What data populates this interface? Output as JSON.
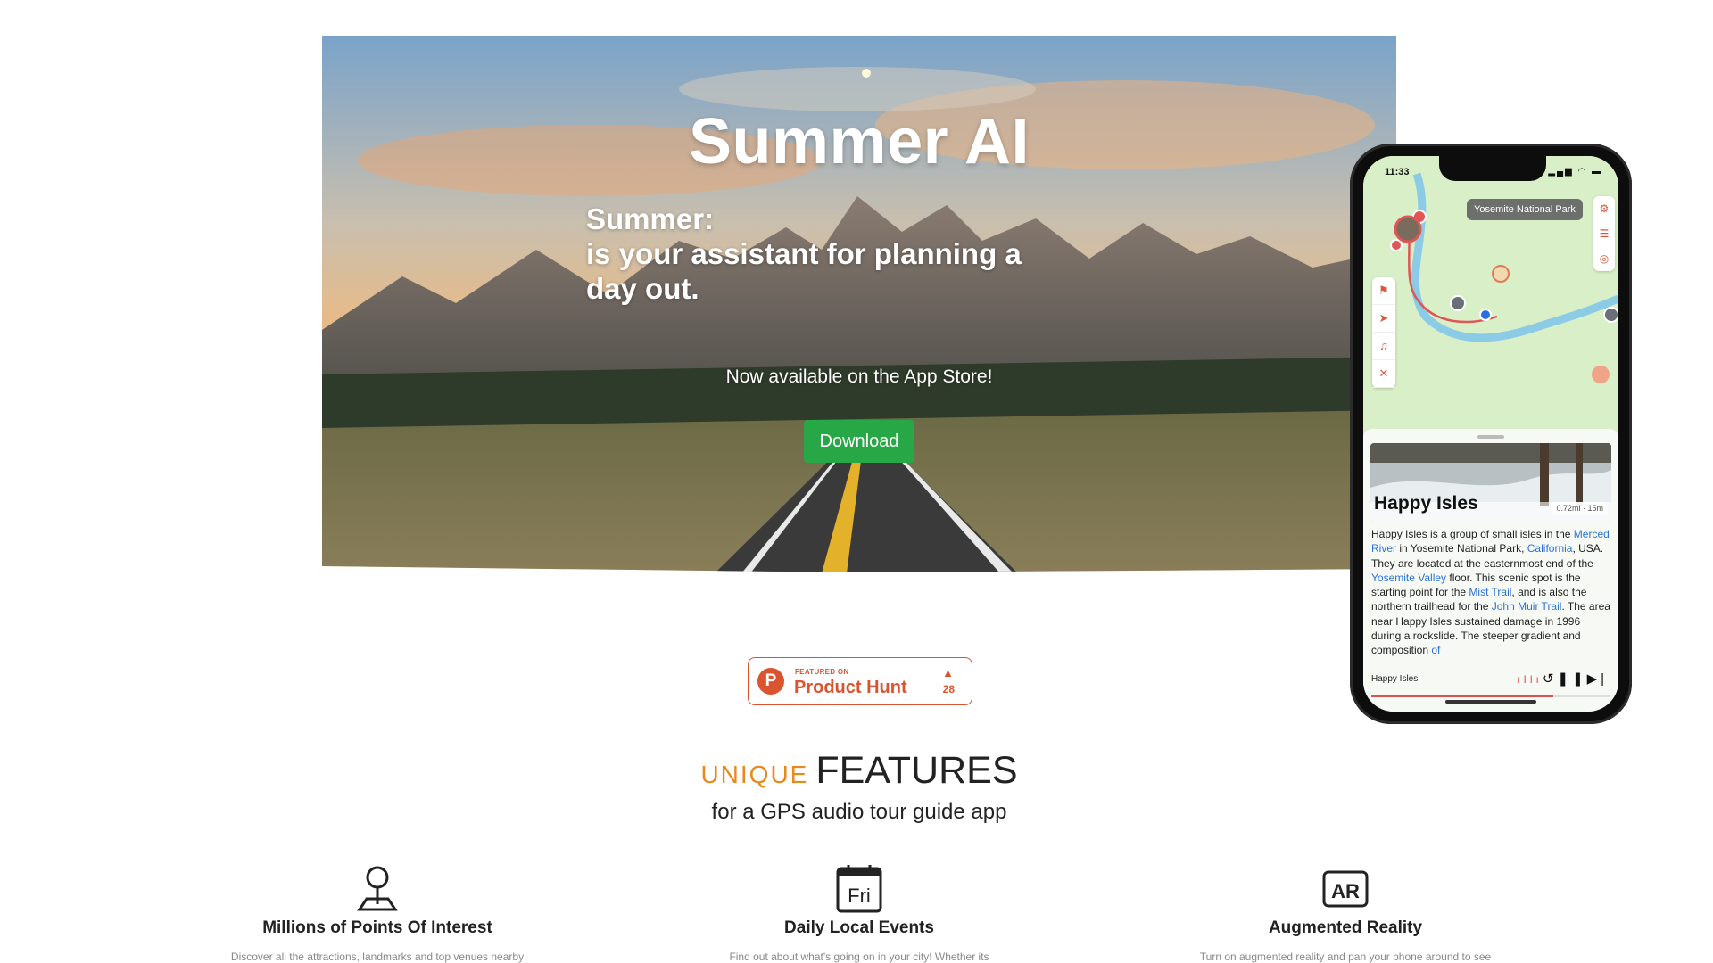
{
  "hero": {
    "title": "Summer AI",
    "subtitle_line1": "Summer:",
    "subtitle_line2": "is your assistant for planning a day out.",
    "availability": "Now available on the App Store!",
    "download_label": "Download"
  },
  "phone": {
    "status_time": "11:33",
    "status_icons": "▂▄▆ ◠ ▬",
    "map_label": "Yosemite National Park",
    "poi_title": "Happy Isles",
    "poi_distance": "0.72mi · 15m",
    "poi_desc": {
      "t1": "Happy Isles is a group of small isles in the ",
      "l1": "Merced River",
      "t2": " in Yosemite National Park, ",
      "l2": "California",
      "t3": ", USA. They are located at the easternmost end of the ",
      "l3": "Yosemite Valley",
      "t4": " floor. This scenic spot is the starting point for the ",
      "l4": "Mist Trail",
      "t5": ", and is also the northern trailhead for the ",
      "l5": "John Muir Trail",
      "t6": ". The area near Happy Isles sustained damage in 1996 during a rockslide. The steeper gradient and composition ",
      "l6": "of"
    },
    "player_name": "Happy Isles",
    "player_progress": 0.76
  },
  "product_hunt": {
    "small": "FEATURED ON",
    "name": "Product Hunt",
    "count": "28"
  },
  "features": {
    "heading_accent": "UNIQUE",
    "heading": "FEATURES",
    "subheading": "for a GPS audio tour guide app",
    "items": [
      {
        "icon": "map-pin-icon",
        "title": "Millions of Points Of Interest",
        "desc": "Discover all the attractions, landmarks and top venues nearby"
      },
      {
        "icon": "calendar-icon",
        "icon_text": "Fri",
        "title": "Daily Local Events",
        "desc": "Find out about what's going on in your city! Whether its"
      },
      {
        "icon": "ar-icon",
        "icon_text": "AR",
        "title": "Augmented Reality",
        "desc": "Turn on augmented reality and pan your phone around to see"
      }
    ]
  },
  "colors": {
    "accent": "#e8891d",
    "download": "#27a745",
    "product_hunt": "#da552f",
    "link": "#2a74d5"
  }
}
